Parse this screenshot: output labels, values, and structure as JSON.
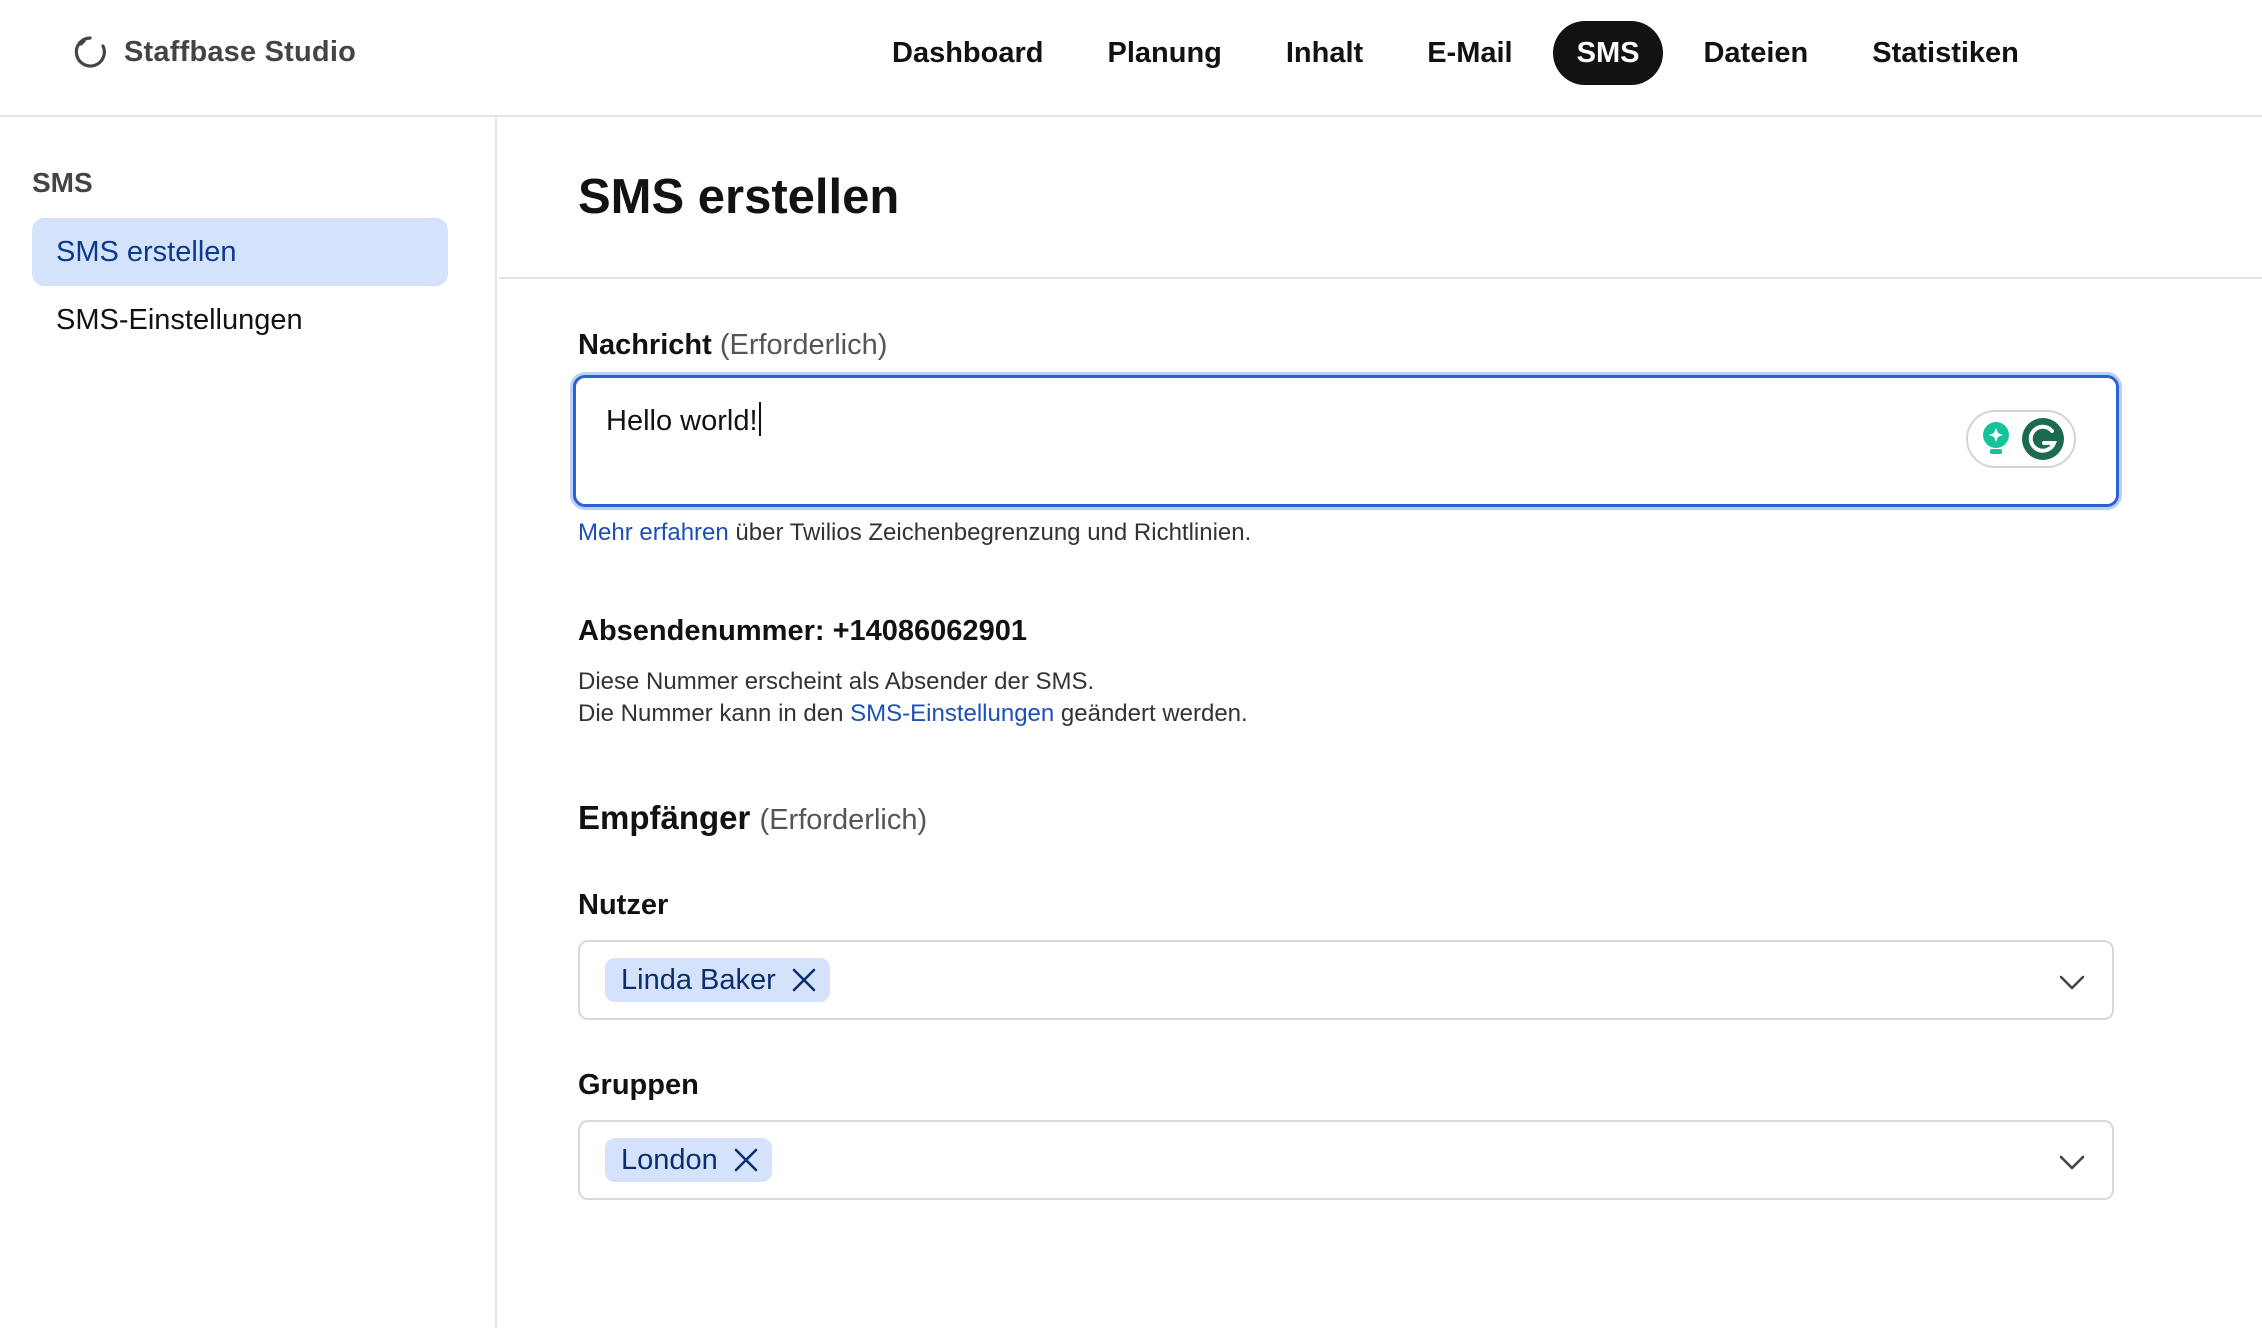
{
  "app": {
    "brand": "Staffbase Studio"
  },
  "nav": {
    "items": [
      {
        "label": "Dashboard"
      },
      {
        "label": "Planung"
      },
      {
        "label": "Inhalt"
      },
      {
        "label": "E-Mail"
      },
      {
        "label": "SMS",
        "active": true
      },
      {
        "label": "Dateien"
      },
      {
        "label": "Statistiken"
      }
    ]
  },
  "sidebar": {
    "title": "SMS",
    "items": [
      {
        "label": "SMS erstellen",
        "active": true
      },
      {
        "label": "SMS-Einstellungen"
      }
    ]
  },
  "main": {
    "title": "SMS erstellen",
    "message": {
      "label": "Nachricht",
      "required": "(Erforderlich)",
      "value": "Hello world!",
      "help_link": "Mehr erfahren",
      "help_text": " über Twilios Zeichenbegrenzung und Richtlinien."
    },
    "sender": {
      "label": "Absendenummer: +14086062901",
      "line1": "Diese Nummer erscheint als Absender der SMS.",
      "line2_prefix": "Die Nummer kann in den ",
      "line2_link": "SMS-Einstellungen",
      "line2_suffix": " geändert werden."
    },
    "recipients": {
      "title": "Empfänger",
      "required": "(Erforderlich)",
      "users_label": "Nutzer",
      "users_chip": "Linda Baker",
      "groups_label": "Gruppen",
      "groups_chip": "London"
    }
  },
  "colors": {
    "accent": "#2a62d6",
    "chip_bg": "#d4e3fb",
    "nav_active_bg": "#121212",
    "link": "#1c4fb8",
    "grammarly_green": "#15c39a"
  }
}
